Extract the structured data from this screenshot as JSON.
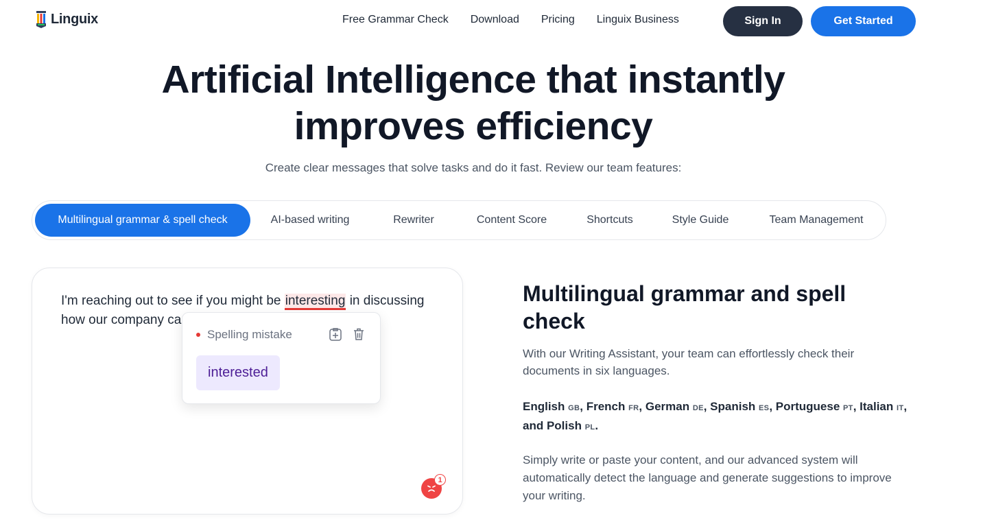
{
  "header": {
    "brand": "Linguix",
    "nav": [
      "Free Grammar Check",
      "Download",
      "Pricing",
      "Linguix Business"
    ],
    "sign_in": "Sign In",
    "get_started": "Get Started"
  },
  "hero": {
    "title_line1": "Artificial Intelligence that instantly",
    "title_line2": "improves efficiency",
    "subtitle": "Create clear messages that solve tasks and do it fast. Review our team features:"
  },
  "tabs": [
    "Multilingual grammar & spell check",
    "AI-based writing",
    "Rewriter",
    "Content Score",
    "Shortcuts",
    "Style Guide",
    "Team Management"
  ],
  "editor": {
    "text_before": "I'm reaching out to see if you might be ",
    "error_word": "interesting",
    "text_after": " in discussing how our company can help your lead gen efforts.",
    "popup": {
      "label": "Spelling mistake",
      "suggestion": "interested"
    },
    "badge_count": "1"
  },
  "feature": {
    "title": "Multilingual grammar and spell check",
    "description": "With our Writing Assistant, your team can effortlessly check their documents in six languages.",
    "languages": [
      {
        "name": "English",
        "code": "GB",
        "sep": ", "
      },
      {
        "name": "French",
        "code": "FR",
        "sep": ", "
      },
      {
        "name": "German",
        "code": "DE",
        "sep": ", "
      },
      {
        "name": "Spanish",
        "code": "ES",
        "sep": ", "
      },
      {
        "name": "Portuguese",
        "code": "PT",
        "sep": ", "
      },
      {
        "name": "Italian",
        "code": "IT",
        "sep": ", and "
      },
      {
        "name": "Polish",
        "code": "PL",
        "sep": "."
      }
    ],
    "more": "Simply write or paste your content, and our advanced system will automatically detect the language and generate suggestions to improve your writing."
  },
  "colors": {
    "primary": "#1a73e8",
    "dark_button": "#263042",
    "error": "#e53935",
    "suggestion_bg": "#ede9fe"
  }
}
